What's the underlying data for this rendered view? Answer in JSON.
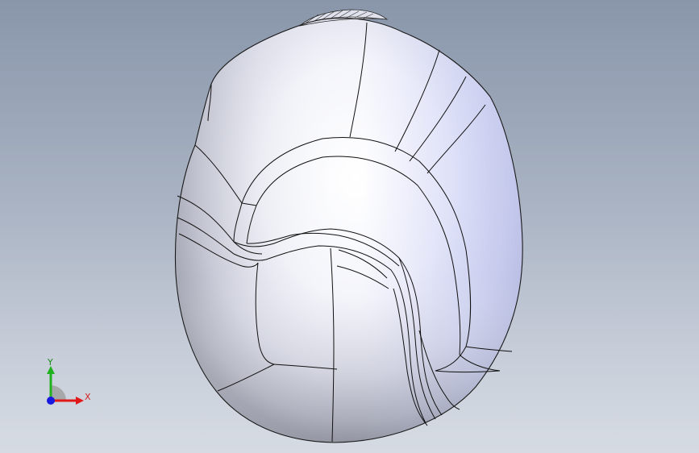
{
  "viewport": {
    "model_part": "helmet-shell-model"
  },
  "triad": {
    "x_label": "X",
    "y_label": "Y",
    "colors": {
      "x": "#e01818",
      "y": "#20b020",
      "z": "#1818e0",
      "hub": "#9a9a9a"
    }
  }
}
